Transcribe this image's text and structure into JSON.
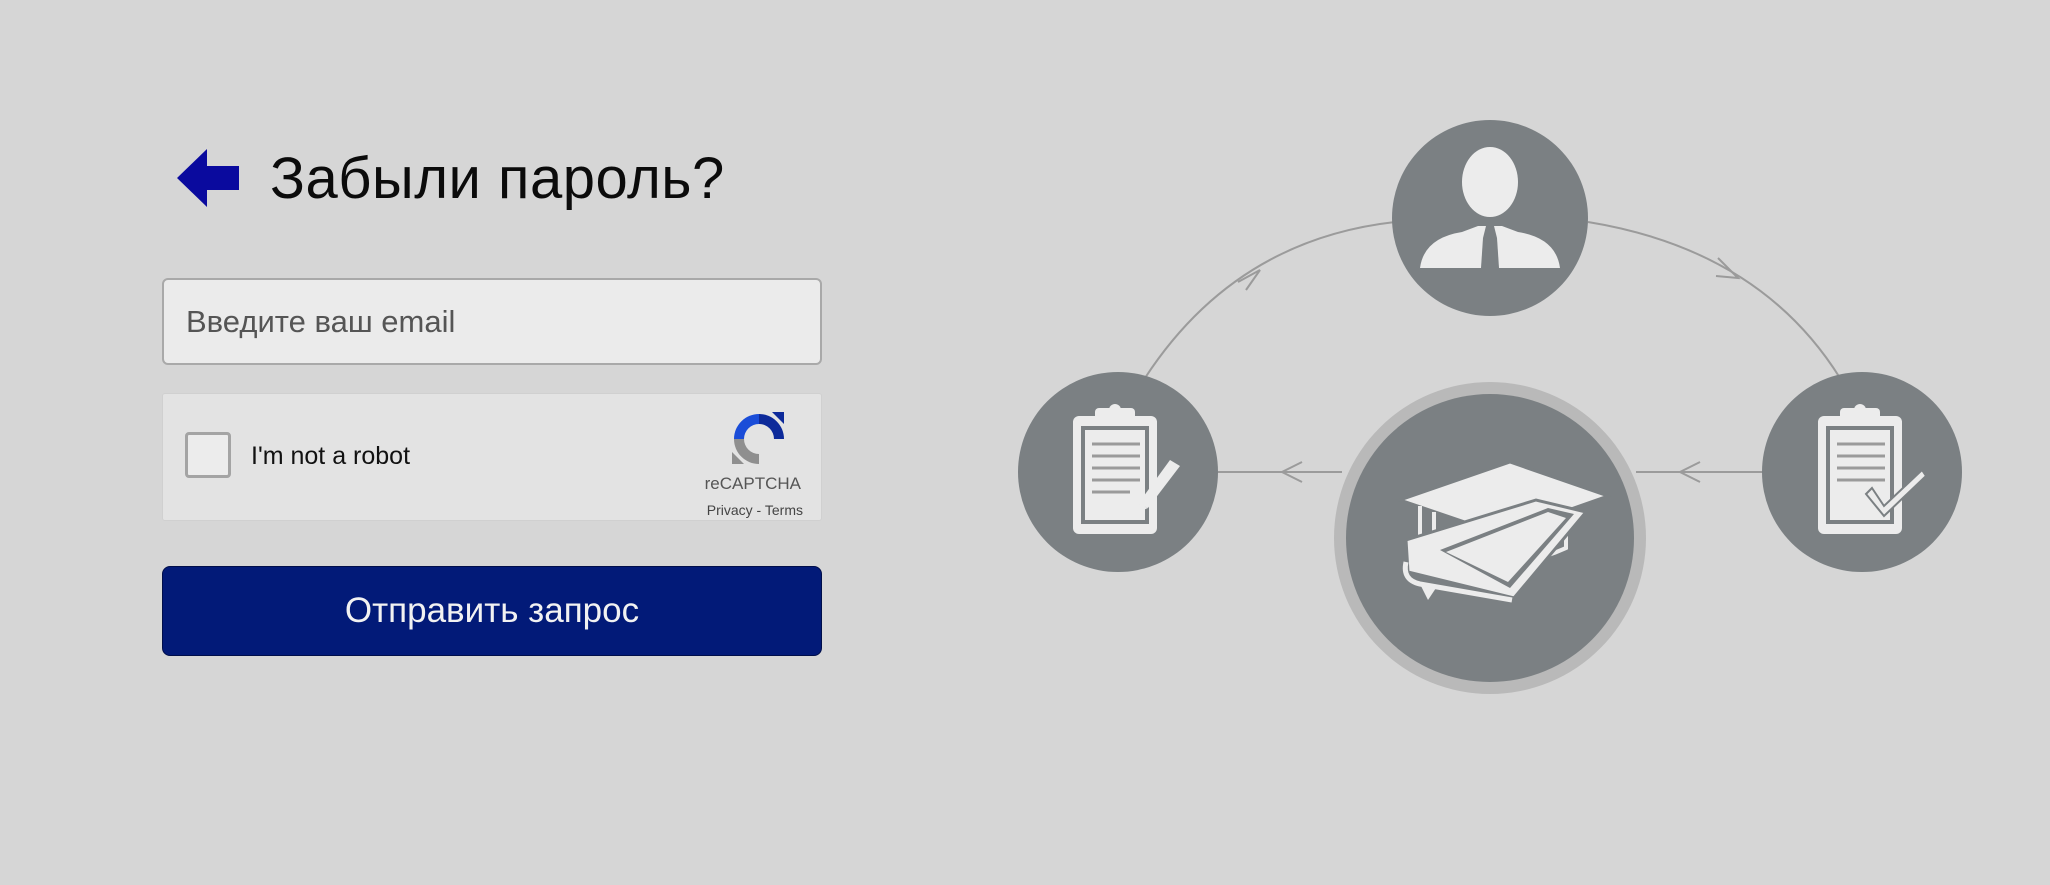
{
  "header": {
    "title": "Забыли пароль?",
    "back_icon": "arrow-left-icon"
  },
  "form": {
    "email_placeholder": "Введите ваш email",
    "email_value": "",
    "submit_label": "Отправить запрос"
  },
  "recaptcha": {
    "label": "I'm not a robot",
    "checked": false,
    "brand": "reCAPTCHA",
    "privacy_link": "Privacy",
    "separator": " - ",
    "terms_link": "Terms"
  },
  "illustration": {
    "icons": [
      "person-icon",
      "clipboard-edit-icon",
      "graduation-book-icon",
      "clipboard-check-icon"
    ]
  },
  "colors": {
    "background": "#d6d6d6",
    "accent": "#021a78",
    "back_arrow": "#0a0a9e",
    "circle_fill": "#7b8083",
    "icon_fill": "#ececec"
  }
}
